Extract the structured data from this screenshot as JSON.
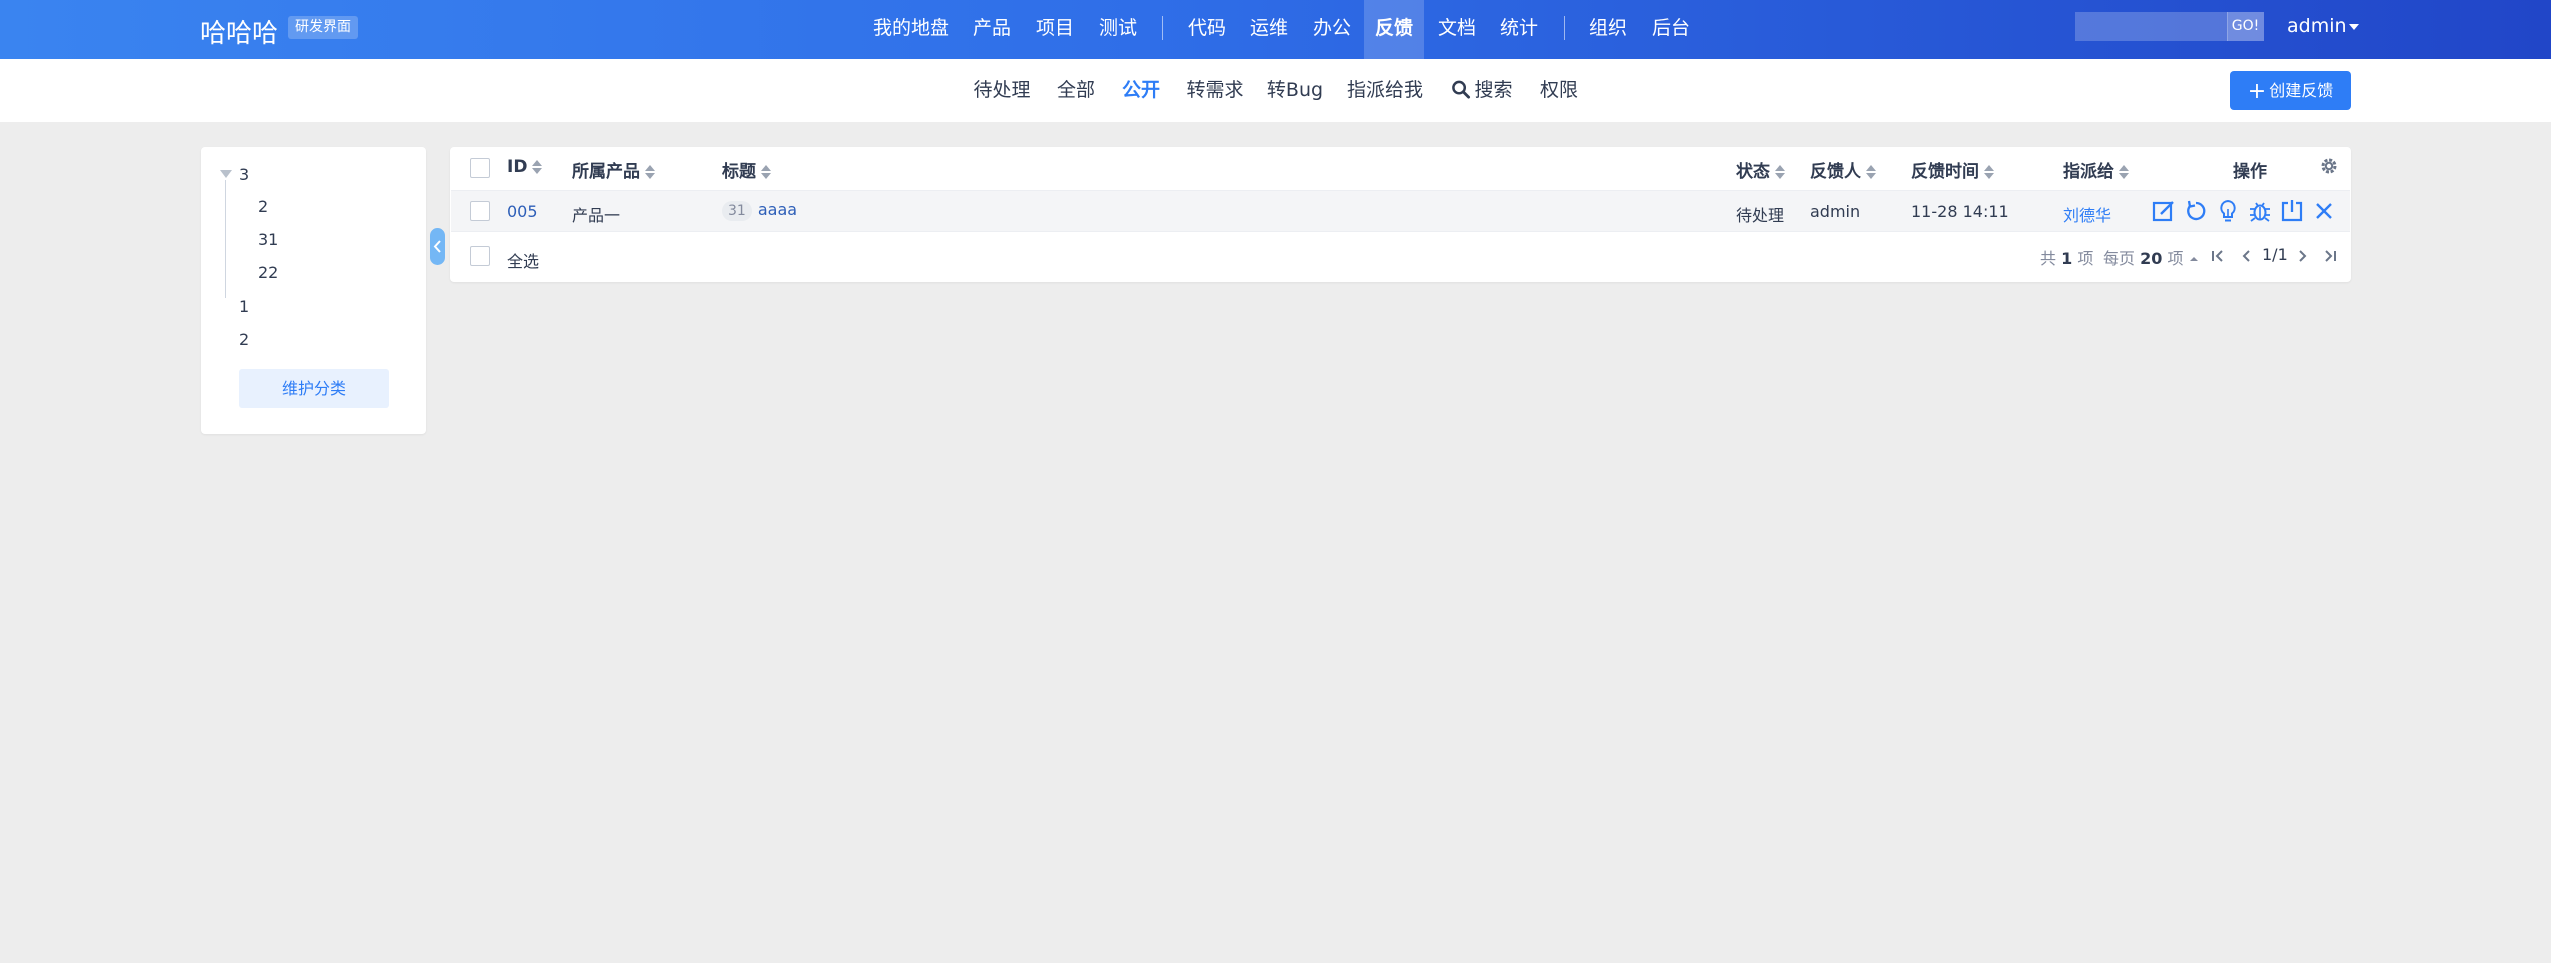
{
  "app": {
    "brand": "哈哈哈",
    "brand_tag": "研发界面"
  },
  "mainnav": {
    "items": [
      {
        "label": "我的地盘"
      },
      {
        "label": "产品"
      },
      {
        "label": "项目"
      },
      {
        "label": "测试"
      },
      {
        "label": "代码"
      },
      {
        "label": "运维"
      },
      {
        "label": "办公"
      },
      {
        "label": "反馈",
        "active": true
      },
      {
        "label": "文档"
      },
      {
        "label": "统计"
      },
      {
        "label": "组织"
      },
      {
        "label": "后台"
      }
    ]
  },
  "search": {
    "placeholder": "",
    "go_label": "GO!"
  },
  "user": {
    "name": "admin"
  },
  "subnav": {
    "items": [
      {
        "label": "待处理"
      },
      {
        "label": "全部"
      },
      {
        "label": "公开",
        "active": true
      },
      {
        "label": "转需求"
      },
      {
        "label": "转Bug"
      },
      {
        "label": "指派给我"
      },
      {
        "label": "搜索",
        "icon": "search-icon"
      },
      {
        "label": "权限"
      }
    ],
    "create_label": "创建反馈"
  },
  "sidebar": {
    "tree": [
      {
        "label": "3",
        "expanded": true,
        "children": [
          {
            "label": "2"
          },
          {
            "label": "31"
          },
          {
            "label": "22"
          }
        ]
      },
      {
        "label": "1"
      },
      {
        "label": "2"
      }
    ],
    "maintain_label": "维护分类"
  },
  "table": {
    "columns": [
      "ID",
      "所属产品",
      "标题",
      "状态",
      "反馈人",
      "反馈时间",
      "指派给",
      "操作"
    ],
    "rows": [
      {
        "id": "005",
        "product": "产品一",
        "title_badge": "31",
        "title": "aaaa",
        "status": "待处理",
        "reporter": "admin",
        "time": "11-28 14:11",
        "assignee": "刘德华",
        "actions": [
          "edit-icon",
          "undo-icon",
          "story-icon",
          "bug-icon",
          "export-icon",
          "close-icon"
        ]
      }
    ],
    "select_all_label": "全选"
  },
  "pager": {
    "total_prefix": "共",
    "total": "1",
    "total_suffix": "项",
    "per_page_prefix": "每页",
    "per_page": "20",
    "per_page_suffix": "项",
    "page": "1/1"
  },
  "colors": {
    "accent": "#2e7df6",
    "topbar_start": "#3a84f0",
    "topbar_end": "#2146c8",
    "background": "#ededed"
  }
}
